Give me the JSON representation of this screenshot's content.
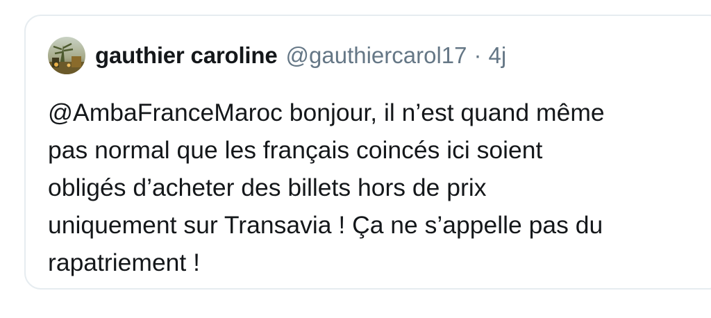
{
  "tweet": {
    "author_name": "gauthier caroline",
    "author_handle": "@gauthiercarol17",
    "separator": "·",
    "time": "4j",
    "avatar_icon": "avatar-photo-icon",
    "lines": [
      "@AmbaFranceMaroc bonjour, il n’est quand même",
      "pas normal que les français coincés ici soient",
      "obligés d’acheter des billets hors de prix",
      "uniquement sur Transavia ! Ça ne s’appelle pas du",
      "rapatriement !"
    ]
  },
  "colors": {
    "text": "#14171a",
    "secondary": "#657786",
    "border": "#e6ecf0"
  }
}
